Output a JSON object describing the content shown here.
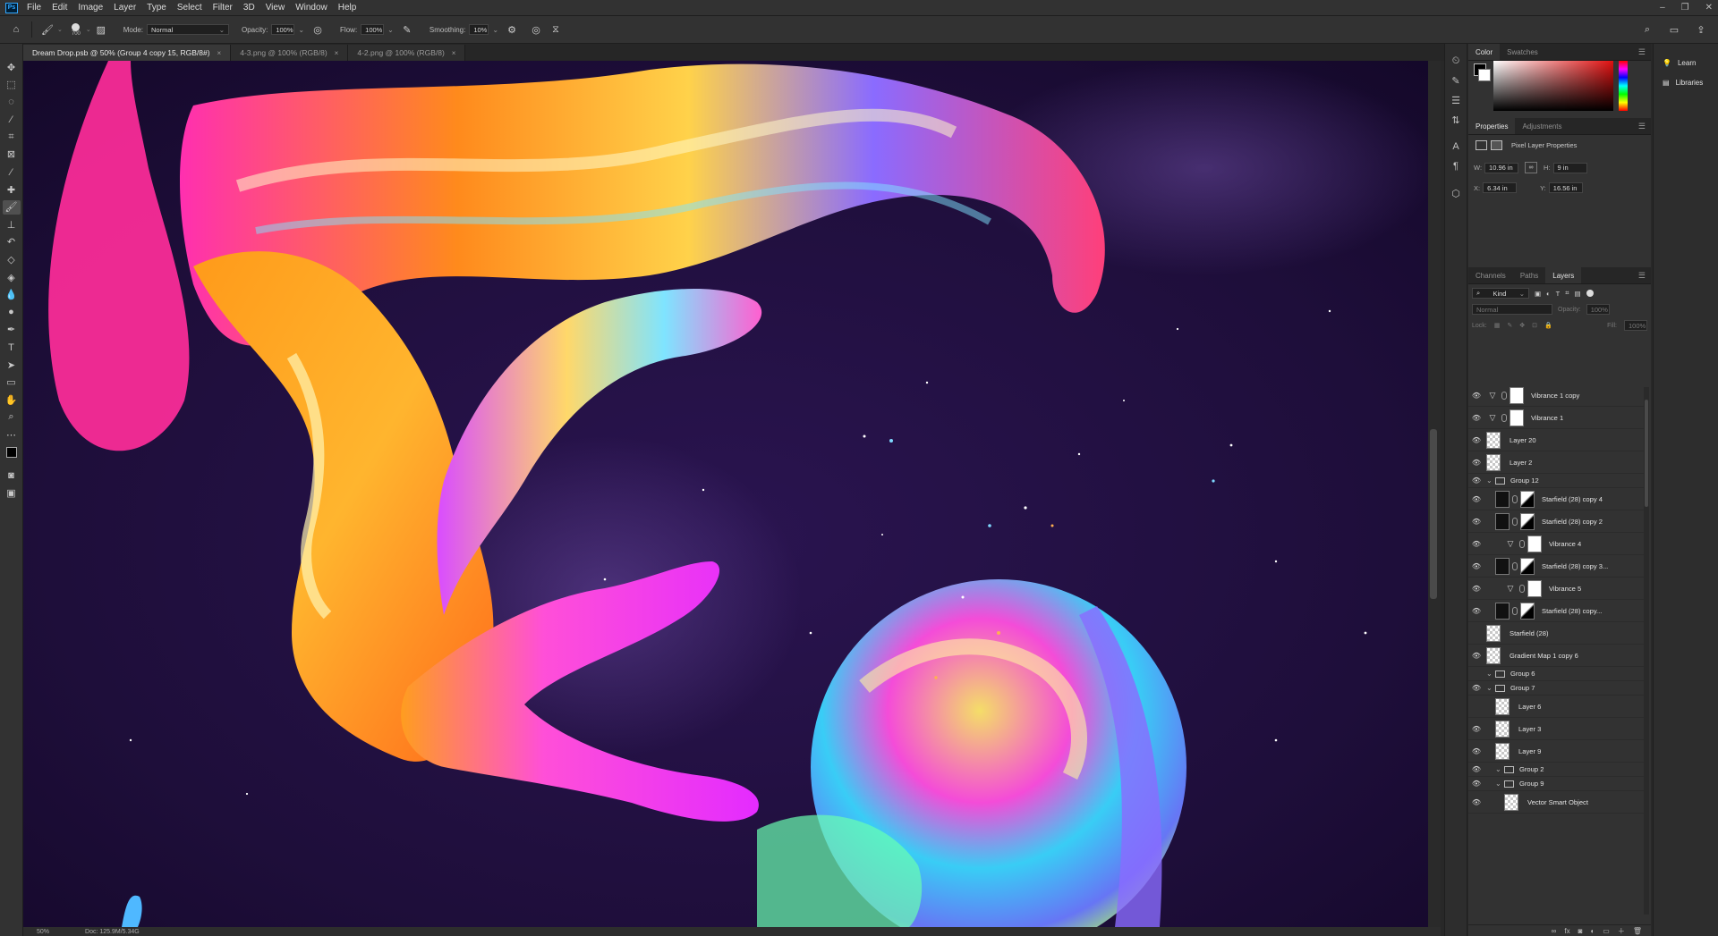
{
  "menubar": {
    "app_icon": "Ps",
    "items": [
      "File",
      "Edit",
      "Image",
      "Layer",
      "Type",
      "Select",
      "Filter",
      "3D",
      "View",
      "Window",
      "Help"
    ]
  },
  "options": {
    "brush_size": "700",
    "mode_label": "Mode:",
    "mode_value": "Normal",
    "opacity_label": "Opacity:",
    "opacity_value": "100%",
    "flow_label": "Flow:",
    "flow_value": "100%",
    "smoothing_label": "Smoothing:",
    "smoothing_value": "10%"
  },
  "tabs": [
    {
      "label": "Dream Drop.psb @ 50% (Group 4 copy 15, RGB/8#)",
      "close": "×"
    },
    {
      "label": "4-3.png @ 100% (RGB/8)",
      "close": "×"
    },
    {
      "label": "4-2.png @ 100% (RGB/8)",
      "close": "×"
    }
  ],
  "status": {
    "zoom": "50%",
    "doc": "Doc: 125.9M/5.34G"
  },
  "color_panel": {
    "tabs": [
      "Color",
      "Swatches"
    ]
  },
  "properties_panel": {
    "tabs": [
      "Properties",
      "Adjustments"
    ],
    "title": "Pixel Layer Properties",
    "w_label": "W:",
    "w_value": "10.96 in",
    "h_label": "H:",
    "h_value": "9 in",
    "x_label": "X:",
    "x_value": "6.34 in",
    "y_label": "Y:",
    "y_value": "16.56 in"
  },
  "layers_panel": {
    "tabs": [
      "Channels",
      "Paths",
      "Layers"
    ],
    "kind_label": "Kind",
    "blend_mode": "Normal",
    "opacity_label": "Opacity:",
    "opacity_value": "100%",
    "lock_label": "Lock:",
    "fill_label": "Fill:",
    "fill_value": "100%",
    "layers": [
      {
        "name": "Vibrance 1 copy",
        "kind": "adj",
        "visible": true,
        "indent": 0
      },
      {
        "name": "Vibrance 1",
        "kind": "adj",
        "visible": true,
        "indent": 0
      },
      {
        "name": "Layer 20",
        "kind": "pixel",
        "visible": true,
        "indent": 0
      },
      {
        "name": "Layer 2",
        "kind": "pixel",
        "visible": true,
        "indent": 0
      },
      {
        "name": "Group 12",
        "kind": "group",
        "visible": true,
        "indent": 0
      },
      {
        "name": "Starfield (28) copy 4",
        "kind": "smart",
        "visible": true,
        "indent": 1
      },
      {
        "name": "Starfield (28) copy 2",
        "kind": "smart",
        "visible": true,
        "indent": 1
      },
      {
        "name": "Vibrance 4",
        "kind": "adj",
        "visible": true,
        "indent": 2
      },
      {
        "name": "Starfield (28) copy 3...",
        "kind": "smart",
        "visible": true,
        "indent": 1
      },
      {
        "name": "Vibrance 5",
        "kind": "adj",
        "visible": true,
        "indent": 2
      },
      {
        "name": "Starfield (28) copy...",
        "kind": "smart",
        "visible": true,
        "indent": 1
      },
      {
        "name": "Starfield (28)",
        "kind": "pixel",
        "visible": false,
        "indent": 0
      },
      {
        "name": "Gradient Map 1 copy 6",
        "kind": "pixel",
        "visible": true,
        "indent": 0
      },
      {
        "name": "Group 6",
        "kind": "group",
        "visible": false,
        "indent": 0
      },
      {
        "name": "Group 7",
        "kind": "group",
        "visible": true,
        "indent": 0
      },
      {
        "name": "Layer 6",
        "kind": "pixel",
        "visible": false,
        "indent": 1
      },
      {
        "name": "Layer 3",
        "kind": "pixel",
        "visible": true,
        "indent": 1
      },
      {
        "name": "Layer 9",
        "kind": "pixel",
        "visible": true,
        "indent": 1
      },
      {
        "name": "Group 2",
        "kind": "group",
        "visible": true,
        "indent": 1
      },
      {
        "name": "Group 9",
        "kind": "group",
        "visible": true,
        "indent": 1
      },
      {
        "name": "Vector Smart Object",
        "kind": "pixel",
        "visible": true,
        "indent": 2
      }
    ]
  },
  "learn_panel": {
    "items": [
      "Learn",
      "Libraries"
    ]
  }
}
